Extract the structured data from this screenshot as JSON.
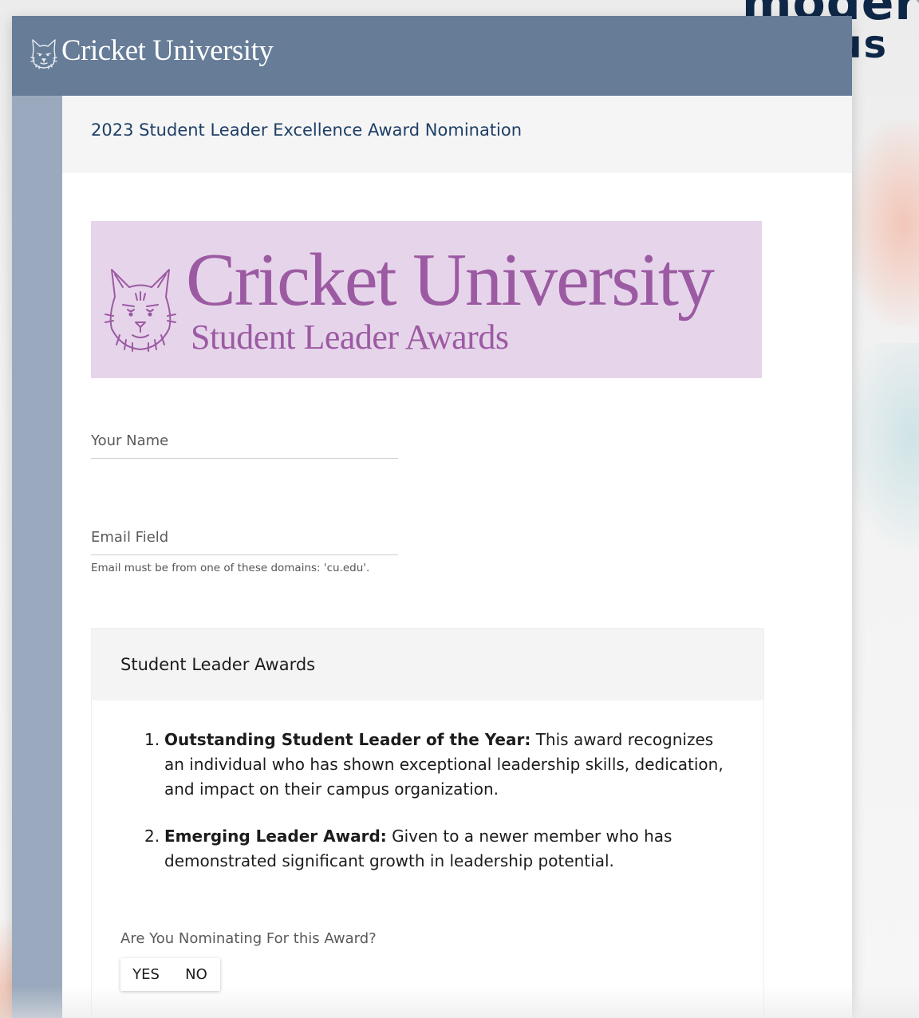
{
  "background": {
    "brand_line1": "modern",
    "brand_line2": "pus",
    "brand_reg": "®"
  },
  "topbar": {
    "app_title": "Cricket University",
    "logo_icon": "cat-mascot-icon",
    "bar_color": "#667c97"
  },
  "page": {
    "title": "2023 Student Leader Excellence Award Nomination"
  },
  "banner": {
    "title": "Cricket University",
    "subtitle": "Student Leader Awards",
    "mascot_icon": "cat-mascot-icon",
    "background_color": "#e6d5ea",
    "text_color": "#9c5aa3"
  },
  "form": {
    "name_field": {
      "placeholder": "Your Name",
      "value": ""
    },
    "email_field": {
      "placeholder": "Email Field",
      "value": "",
      "helper": "Email must be from one of these domains: 'cu.edu'."
    }
  },
  "awards_card": {
    "title": "Student Leader Awards",
    "awards": [
      {
        "number": "1.",
        "name": "Outstanding Student Leader of the Year:",
        "description": "This award recognizes an individual who has shown exceptional leadership skills, dedication, and impact on their campus organization."
      },
      {
        "number": "2.",
        "name": "Emerging Leader Award:",
        "description": "Given to a newer member who has demonstrated significant growth in leadership potential."
      }
    ],
    "question": "Are You Nominating For this Award?",
    "options": {
      "yes": "YES",
      "no": "NO"
    }
  }
}
